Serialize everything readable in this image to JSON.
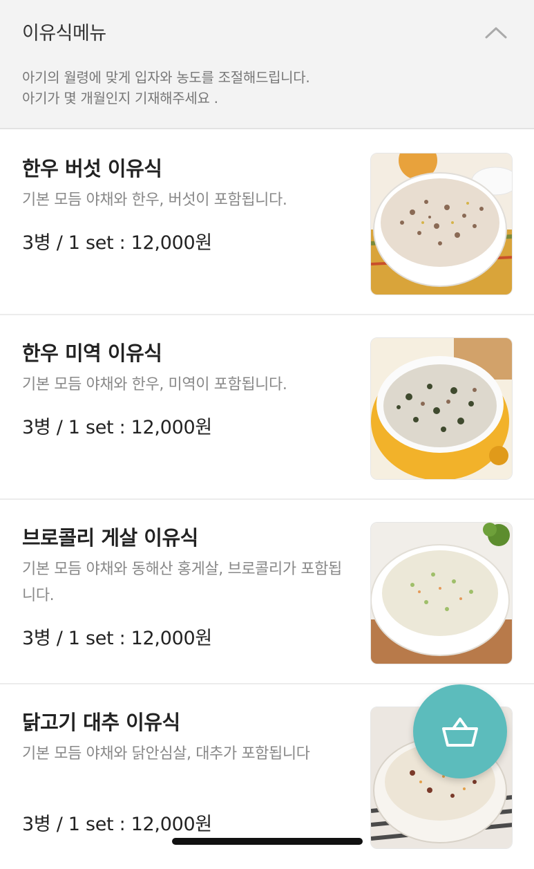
{
  "header": {
    "title": "이유식메뉴",
    "description_lines": [
      "아기의 월령에 맞게 입자와 농도를 조절해드립니다.",
      "아기가 몇 개월인지 기재해주세요 ."
    ]
  },
  "menu": {
    "items": [
      {
        "name": "한우 버섯 이유식",
        "description": "기본 모듬 야채와 한우, 버섯이 포함됩니다.",
        "price": "3병 / 1 set : 12,000원"
      },
      {
        "name": "한우 미역 이유식",
        "description": "기본 모듬 야채와 한우, 미역이 포함됩니다.",
        "price": "3병 / 1 set : 12,000원"
      },
      {
        "name": "브로콜리 게살 이유식",
        "description": "기본 모듬 야채와 동해산 홍게살, 브로콜리가 포함됩니다.",
        "price": "3병 / 1 set : 12,000원"
      },
      {
        "name": "닭고기 대추 이유식",
        "description": "기본 모듬 야채와 닭안심살, 대추가 포함됩니다",
        "price": "3병 / 1 set : 12,000원"
      }
    ]
  },
  "icons": {
    "collapse": "chevron-up-icon",
    "cart": "shopping-basket-icon"
  },
  "colors": {
    "accent": "#5cbcbc",
    "header_bg": "#f3f3f3"
  }
}
